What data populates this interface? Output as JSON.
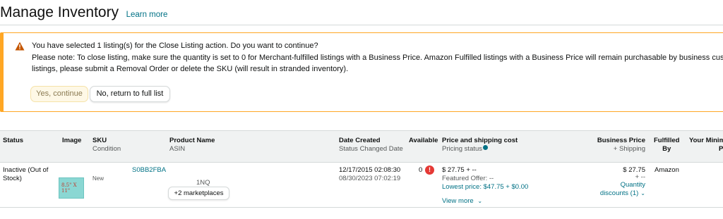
{
  "header": {
    "title": "Manage Inventory",
    "learn_more": "Learn more"
  },
  "alert": {
    "line1": "You have selected 1 listing(s) for the Close Listing action. Do you want to continue?",
    "line2": "Please note: To close listing, make sure the quantity is set to 0 for Merchant-fulfilled listings with a Business Price. Amazon Fulfilled listings with a Business Price will remain purchasable by business customers.",
    "line3": "listings, please submit a Removal Order or delete the SKU (will result in stranded inventory).",
    "yes_label": "Yes, continue",
    "no_label": "No, return to full list",
    "accent_color": "#ffa724"
  },
  "table": {
    "headers": {
      "status": "Status",
      "image": "Image",
      "sku": "SKU",
      "sku_sub": "Condition",
      "product": "Product Name",
      "product_sub": "ASIN",
      "date": "Date Created",
      "date_sub": "Status Changed Date",
      "available": "Available",
      "price": "Price and shipping cost",
      "price_sub": "Pricing status",
      "business": "Business Price",
      "business_sub": "+ Shipping",
      "fulfilled_1": "Fulfilled",
      "fulfilled_2": "By",
      "min_1": "Your Minimu",
      "min_2": "P"
    },
    "row": {
      "status_1": "Inactive (Out of",
      "status_2": "Stock)",
      "image_text": "8.5\" X 11\"",
      "sku": "S0BB2FBA",
      "condition": "New",
      "asin": "1NQ",
      "marketplaces": "+2 marketplaces",
      "date_created": "12/17/2015 02:08:30",
      "status_changed": "08/30/2023 07:02:19",
      "available": "0",
      "price": "$ 27.75 + --",
      "featured_offer": "Featured Offer: --",
      "lowest_price": "Lowest price: $47.75 + $0.00",
      "view_more": "View more",
      "business_price": "$ 27.75",
      "business_ship": "+ --",
      "quantity_discounts_1": "Quantity",
      "quantity_discounts_2": "discounts (1)",
      "fulfilled_by": "Amazon"
    }
  }
}
